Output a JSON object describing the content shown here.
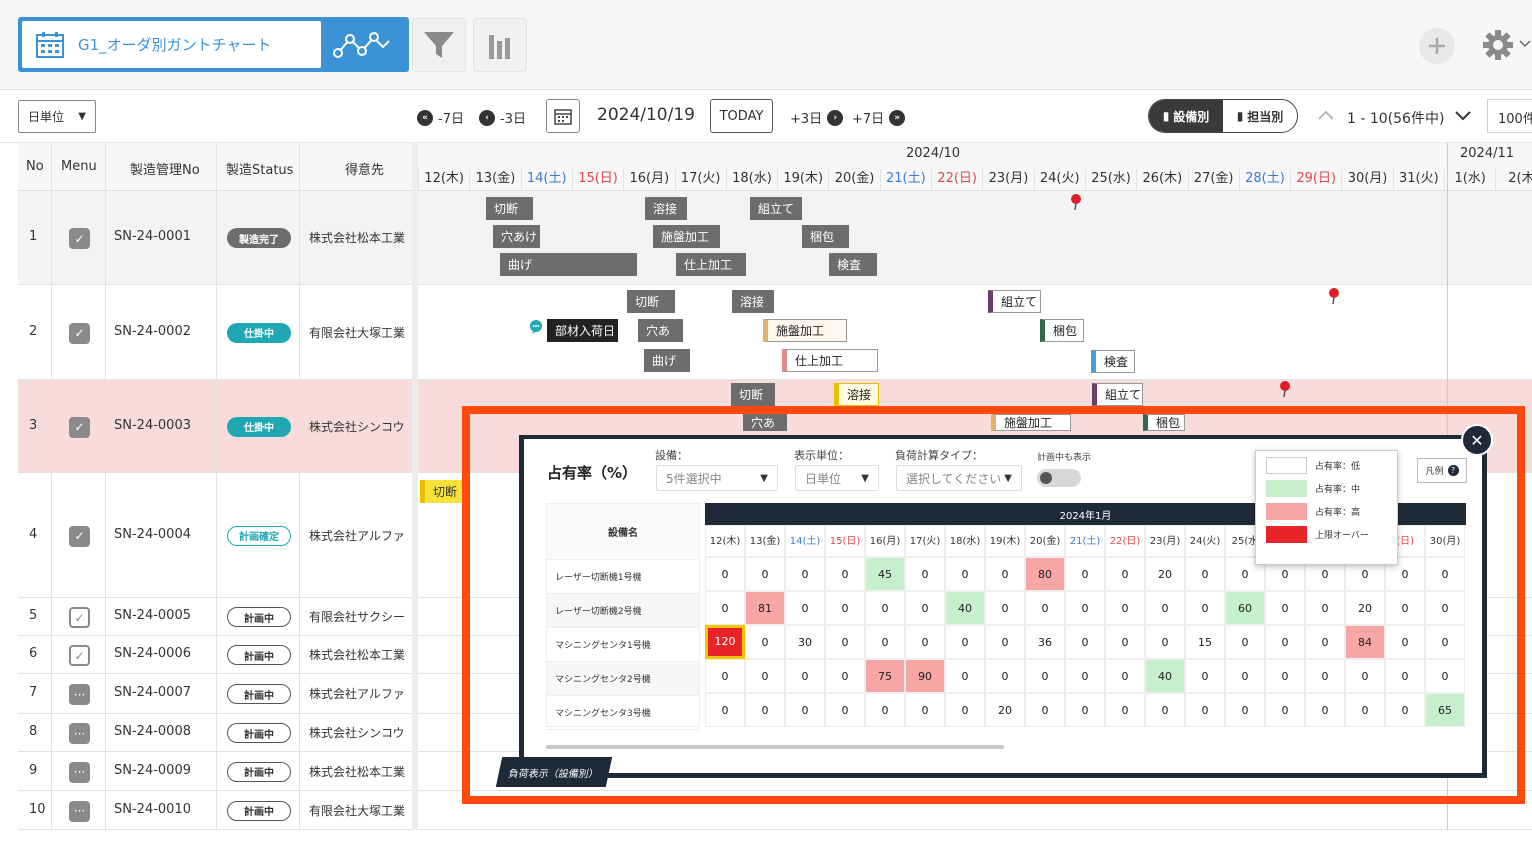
{
  "header": {
    "view_title": "G1_オーダ別ガントチャート"
  },
  "toolbar": {
    "unit_select": "日単位",
    "prev7": "-7日",
    "prev3": "-3日",
    "date": "2024/10/19",
    "today": "TODAY",
    "next3": "+3日",
    "next7": "+7日",
    "toggle_equipment": "設備別",
    "toggle_person": "担当別",
    "page_info": "1 - 10(56件中)",
    "per_page": "100件"
  },
  "table": {
    "headers": {
      "no": "No",
      "menu": "Menu",
      "order": "製造管理No",
      "status": "製造Status",
      "customer": "得意先"
    },
    "rows": [
      {
        "no": "1",
        "order": "SN-24-0001",
        "status": "製造完了",
        "customer": "株式会社松本工業"
      },
      {
        "no": "2",
        "order": "SN-24-0002",
        "status": "仕掛中",
        "customer": "有限会社大塚工業"
      },
      {
        "no": "3",
        "order": "SN-24-0003",
        "status": "仕掛中",
        "customer": "株式会社シンコウ"
      },
      {
        "no": "4",
        "order": "SN-24-0004",
        "status": "計画確定",
        "customer": "株式会社アルファ"
      },
      {
        "no": "5",
        "order": "SN-24-0005",
        "status": "計画中",
        "customer": "有限会社サクシー"
      },
      {
        "no": "6",
        "order": "SN-24-0006",
        "status": "計画中",
        "customer": "株式会社松本工業"
      },
      {
        "no": "7",
        "order": "SN-24-0007",
        "status": "計画中",
        "customer": "株式会社アルファ"
      },
      {
        "no": "8",
        "order": "SN-24-0008",
        "status": "計画中",
        "customer": "株式会社シンコウ"
      },
      {
        "no": "9",
        "order": "SN-24-0009",
        "status": "計画中",
        "customer": "株式会社松本工業"
      },
      {
        "no": "10",
        "order": "SN-24-0010",
        "status": "計画中",
        "customer": "有限会社大塚工業"
      }
    ]
  },
  "gantt": {
    "month1": "2024/10",
    "month2": "2024/11",
    "days": [
      "12(木)",
      "13(金)",
      "14(土)",
      "15(日)",
      "16(月)",
      "17(火)",
      "18(水)",
      "19(木)",
      "20(金)",
      "21(土)",
      "22(日)",
      "23(月)",
      "24(火)",
      "25(水)",
      "26(木)",
      "27(金)",
      "28(土)",
      "29(日)",
      "30(月)",
      "31(火)",
      "1(水)",
      "2(木"
    ],
    "tasks": {
      "r1": [
        "切断",
        "溶接",
        "組立て",
        "穴あけ",
        "施盤加工",
        "梱包",
        "曲げ",
        "仕上加工",
        "検査"
      ],
      "r2": [
        "切断",
        "溶接",
        "組立て",
        "部材入荷日",
        "穴あ",
        "施盤加工",
        "梱包",
        "曲げ",
        "仕上加工",
        "検査"
      ],
      "r3": [
        "切断",
        "溶接",
        "組立て",
        "穴あ",
        "施盤加工",
        "梱包"
      ],
      "r4": [
        "切断"
      ]
    }
  },
  "load_panel": {
    "title": "占有率（%）",
    "equip_label": "設備：",
    "equip_value": "5件選択中",
    "unit_label": "表示単位：",
    "unit_value": "日単位",
    "calc_label": "負荷計算タイプ：",
    "calc_placeholder": "選択してください",
    "plan_label": "計画中も表示",
    "legend_button": "凡例",
    "equip_col": "設備名",
    "month": "2024年1月",
    "days": [
      "12(木)",
      "13(金)",
      "14(土)",
      "15(日)",
      "16(月)",
      "17(火)",
      "18(水)",
      "19(木)",
      "20(金)",
      "21(土)",
      "22(日)",
      "23(月)",
      "24(火)",
      "25(水",
      "",
      "",
      "",
      "(日)",
      "30(月)"
    ],
    "equipments": [
      {
        "name": "レーザー切断機1号機",
        "values": [
          "0",
          "0",
          "0",
          "0",
          "45",
          "0",
          "0",
          "0",
          "80",
          "0",
          "0",
          "20",
          "0",
          "0",
          "0",
          "0",
          "0",
          "0",
          "0"
        ]
      },
      {
        "name": "レーザー切断機2号機",
        "values": [
          "0",
          "81",
          "0",
          "0",
          "0",
          "0",
          "40",
          "0",
          "0",
          "0",
          "0",
          "0",
          "0",
          "60",
          "0",
          "0",
          "20",
          "0",
          "0"
        ]
      },
      {
        "name": "マシニングセンタ1号機",
        "values": [
          "120",
          "0",
          "30",
          "0",
          "0",
          "0",
          "0",
          "0",
          "36",
          "0",
          "0",
          "0",
          "15",
          "0",
          "0",
          "0",
          "84",
          "0",
          "0"
        ]
      },
      {
        "name": "マシニングセンタ2号機",
        "values": [
          "0",
          "0",
          "0",
          "0",
          "75",
          "90",
          "0",
          "0",
          "0",
          "0",
          "0",
          "40",
          "0",
          "0",
          "0",
          "0",
          "0",
          "0",
          "0"
        ]
      },
      {
        "name": "マシニングセンタ3号機",
        "values": [
          "0",
          "0",
          "0",
          "0",
          "0",
          "0",
          "0",
          "20",
          "0",
          "0",
          "0",
          "0",
          "0",
          "0",
          "0",
          "0",
          "0",
          "0",
          "65"
        ]
      }
    ],
    "tab_label": "負荷表示（設備別）",
    "legend": [
      "占有率：低",
      "占有率：中",
      "占有率：高",
      "上限オーバー"
    ],
    "colors": {
      "low": "#ffffff",
      "mid": "#c6efce",
      "high": "#f8a5a5",
      "over": "#e8232a"
    }
  }
}
